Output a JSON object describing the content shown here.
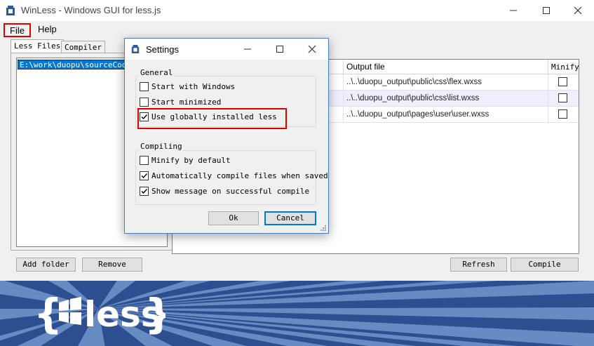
{
  "window": {
    "title": "WinLess - Windows GUI for less.js"
  },
  "menu": {
    "file": "File",
    "help": "Help"
  },
  "tabs": [
    {
      "label": "Less Files"
    },
    {
      "label": "Compiler"
    }
  ],
  "folders": [
    "E:\\work\\duopu\\sourceCode\\"
  ],
  "table": {
    "headers": {
      "output": "Output file",
      "minify": "Minify"
    },
    "rows": [
      {
        "output": "..\\..\\duopu_output\\public\\css\\flex.wxss",
        "minify": false
      },
      {
        "output": "..\\..\\duopu_output\\public\\css\\list.wxss",
        "minify": false
      },
      {
        "output": "..\\..\\duopu_output\\pages\\user\\user.wxss",
        "minify": false
      }
    ]
  },
  "buttons": {
    "add_folder": "Add folder",
    "remove": "Remove",
    "refresh": "Refresh",
    "compile": "Compile"
  },
  "banner": {
    "logo_text": "{less}"
  },
  "settings": {
    "title": "Settings",
    "general": {
      "label": "General",
      "options": [
        {
          "label": "Start with Windows",
          "checked": false
        },
        {
          "label": "Start minimized",
          "checked": false
        },
        {
          "label": "Use globally installed less",
          "checked": true,
          "highlighted": true
        }
      ]
    },
    "compiling": {
      "label": "Compiling",
      "options": [
        {
          "label": "Minify by default",
          "checked": false
        },
        {
          "label": "Automatically compile files when saved",
          "checked": true
        },
        {
          "label": "Show message on successful compile",
          "checked": true
        }
      ]
    },
    "ok": "Ok",
    "cancel": "Cancel"
  },
  "colors": {
    "accent": "#0078d7",
    "highlight_box": "#e00000",
    "banner_dark": "#2e4f8f",
    "banner_light": "#6e93c9"
  },
  "icons": [
    "app-icon",
    "minimize-icon",
    "maximize-icon",
    "close-icon",
    "checkmark-icon",
    "size-grip-icon"
  ]
}
